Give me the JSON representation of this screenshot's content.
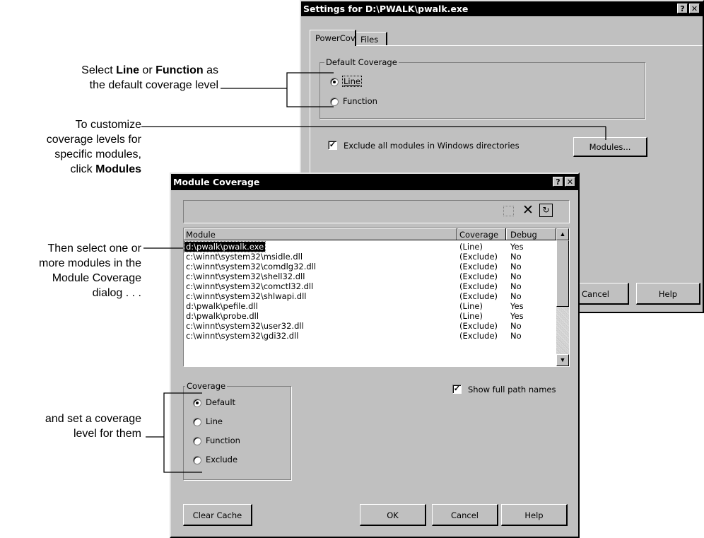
{
  "settings_dialog": {
    "title": "Settings for D:\\PWALK\\pwalk.exe",
    "help_btn": "?",
    "close_btn": "✕",
    "tabs": [
      "PowerCov",
      "Files"
    ],
    "group_label": "Default Coverage",
    "radio_line": "Line",
    "radio_function": "Function",
    "exclude_label": "Exclude all modules in Windows directories",
    "modules_btn": "Modules...",
    "cancel_btn": "Cancel",
    "help_button": "Help"
  },
  "module_dialog": {
    "title": "Module Coverage",
    "help_btn": "?",
    "close_btn": "✕",
    "columns": [
      "Module",
      "Coverage",
      "Debug"
    ],
    "rows": [
      {
        "module": "d:\\pwalk\\pwalk.exe",
        "coverage": "(Line)",
        "debug": "Yes"
      },
      {
        "module": "c:\\winnt\\system32\\msidle.dll",
        "coverage": "(Exclude)",
        "debug": "No"
      },
      {
        "module": "c:\\winnt\\system32\\comdlg32.dll",
        "coverage": "(Exclude)",
        "debug": "No"
      },
      {
        "module": "c:\\winnt\\system32\\shell32.dll",
        "coverage": "(Exclude)",
        "debug": "No"
      },
      {
        "module": "c:\\winnt\\system32\\comctl32.dll",
        "coverage": "(Exclude)",
        "debug": "No"
      },
      {
        "module": "c:\\winnt\\system32\\shlwapi.dll",
        "coverage": "(Exclude)",
        "debug": "No"
      },
      {
        "module": "d:\\pwalk\\pefile.dll",
        "coverage": "(Line)",
        "debug": "Yes"
      },
      {
        "module": "d:\\pwalk\\probe.dll",
        "coverage": "(Line)",
        "debug": "Yes"
      },
      {
        "module": "c:\\winnt\\system32\\user32.dll",
        "coverage": "(Exclude)",
        "debug": "No"
      },
      {
        "module": "c:\\winnt\\system32\\gdi32.dll",
        "coverage": "(Exclude)",
        "debug": "No"
      }
    ],
    "coverage_group": "Coverage",
    "radios": [
      "Default",
      "Line",
      "Function",
      "Exclude"
    ],
    "show_full_paths": "Show full path names",
    "clear_cache": "Clear Cache",
    "ok": "OK",
    "cancel": "Cancel",
    "help": "Help"
  },
  "annotations": {
    "a1_pre": "Select ",
    "a1_b1": "Line",
    "a1_mid": " or ",
    "a1_b2": "Function",
    "a1_post": " as",
    "a1_line2": "the default coverage level",
    "a2_line1": "To customize",
    "a2_line2": "coverage levels for",
    "a2_line3": "specific modules,",
    "a2_pre": "click ",
    "a2_b": "Modules",
    "a3_line1": "Then select one or",
    "a3_line2": "more modules in the",
    "a3_line3": "Module Coverage",
    "a3_line4": "dialog  .  .  .",
    "a4_line1": "and set a coverage",
    "a4_line2": "level for them"
  },
  "colors": {
    "dialog_face": "#c0c0c0",
    "title_bar": "#000000",
    "selection": "#000000"
  }
}
